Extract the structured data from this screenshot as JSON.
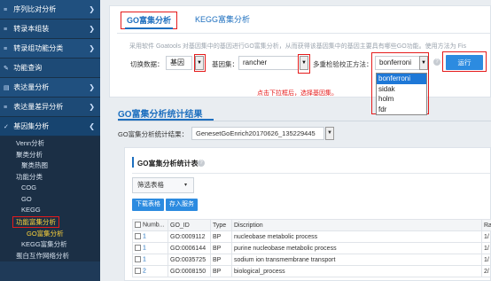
{
  "sidebar": {
    "items": [
      {
        "label": "序列比对分析",
        "icon": "≡"
      },
      {
        "label": "转录本组装",
        "icon": "≡"
      },
      {
        "label": "转录组功能分类",
        "icon": "≡"
      },
      {
        "label": "功能查询",
        "icon": "✎"
      },
      {
        "label": "表达量分析",
        "icon": "▤"
      },
      {
        "label": "表达量差异分析",
        "icon": "≡"
      },
      {
        "label": "基因集分析",
        "icon": "✓"
      }
    ],
    "chevron_collapsed": "❯",
    "chevron_expanded": "❮",
    "subitems": [
      {
        "label": "Venn分析",
        "level": 1
      },
      {
        "label": "聚类分析",
        "level": 1
      },
      {
        "label": "聚类热图",
        "level": 2
      },
      {
        "label": "功能分类",
        "level": 1
      },
      {
        "label": "COG",
        "level": 2
      },
      {
        "label": "GO",
        "level": 2
      },
      {
        "label": "KEGG",
        "level": 2
      },
      {
        "label": "功能富集分析",
        "level": 1
      },
      {
        "label": "GO富集分析",
        "level": 2
      },
      {
        "label": "KEGG富集分析",
        "level": 2
      },
      {
        "label": "蛋白互作网络分析",
        "level": 1
      }
    ]
  },
  "tabs": {
    "go": "GO富集分析",
    "kegg": "KEGG富集分析"
  },
  "description": "采用软件 Goatools 对基因集中的基因进行GO富集分析，从而获得该基因集中的基因主要具有哪些GO功能。使用方法为 Fis",
  "form": {
    "input_label": "切换数据：",
    "input_value": "基因",
    "geneset_label": "基因集：",
    "geneset_value": "rancher",
    "correction_label": "多重检验校正方法：",
    "correction_value": "bonferroni",
    "help": "?",
    "run_label": "运行",
    "dropdown_glyph": "▼",
    "options": [
      "bonferroni",
      "sidak",
      "holm",
      "fdr"
    ]
  },
  "annotation": "点击下拉框后，选择基因集。",
  "results": {
    "title": "GO富集分析统计结果",
    "result_label": "GO富集分析统计结果：",
    "result_value": "GenesetGoEnrich20170626_135229445",
    "table_title": "GO富集分析统计表",
    "info": "?",
    "filter_label": "筛选表格",
    "filter_caret": "▾",
    "download_label": "下载表格",
    "save_label": "存入服务",
    "columns": [
      "Numb...",
      "GO_ID",
      "Type",
      "Discription",
      "Ra"
    ],
    "rows": [
      {
        "num": "1",
        "go_id": "GO:0009112",
        "type": "BP",
        "desc": "nucleobase metabolic process",
        "ra": "1/"
      },
      {
        "num": "1",
        "go_id": "GO:0006144",
        "type": "BP",
        "desc": "purine nucleobase metabolic process",
        "ra": "1/"
      },
      {
        "num": "1",
        "go_id": "GO:0035725",
        "type": "BP",
        "desc": "sodium ion transmembrane transport",
        "ra": "1/"
      },
      {
        "num": "2",
        "go_id": "GO:0008150",
        "type": "BP",
        "desc": "biological_process",
        "ra": "2/"
      }
    ]
  }
}
